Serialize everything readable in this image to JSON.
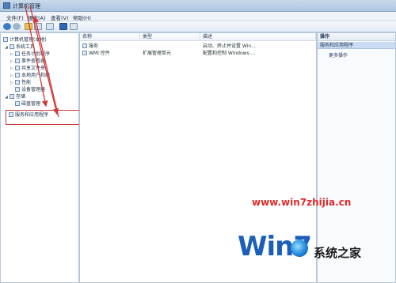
{
  "window": {
    "title": "计算机管理"
  },
  "menu": [
    "文件(F)",
    "操作(A)",
    "查看(V)",
    "帮助(H)"
  ],
  "tree": [
    {
      "label": "计算机管理(本地)",
      "level": 0,
      "exp": ""
    },
    {
      "label": "系统工具",
      "level": 1,
      "exp": "◢"
    },
    {
      "label": "任务计划程序",
      "level": 2,
      "exp": "▷"
    },
    {
      "label": "事件查看器",
      "level": 2,
      "exp": "▷"
    },
    {
      "label": "共享文件夹",
      "level": 2,
      "exp": "▷"
    },
    {
      "label": "本地用户和组",
      "level": 2,
      "exp": "▷"
    },
    {
      "label": "性能",
      "level": 2,
      "exp": "▷"
    },
    {
      "label": "设备管理器",
      "level": 2,
      "exp": ""
    },
    {
      "label": "存储",
      "level": 1,
      "exp": "◢"
    },
    {
      "label": "磁盘管理",
      "level": 2,
      "exp": ""
    },
    {
      "label": "服务和应用程序",
      "level": 1,
      "exp": ""
    }
  ],
  "columns": [
    "名称",
    "类型",
    "描述"
  ],
  "rows": [
    {
      "name": "服务",
      "type": "",
      "desc": "启动、终止并设置 Win..."
    },
    {
      "name": "WMI 控件",
      "type": "扩展管理单元",
      "desc": "配置和控制 Windows ..."
    }
  ],
  "ops": {
    "header": "操作",
    "selected": "服务和应用程序",
    "more": "更多操作"
  },
  "watermark": {
    "url": "www.win7zhijia.cn",
    "logo": "Win7",
    "cn": "系统之家"
  }
}
